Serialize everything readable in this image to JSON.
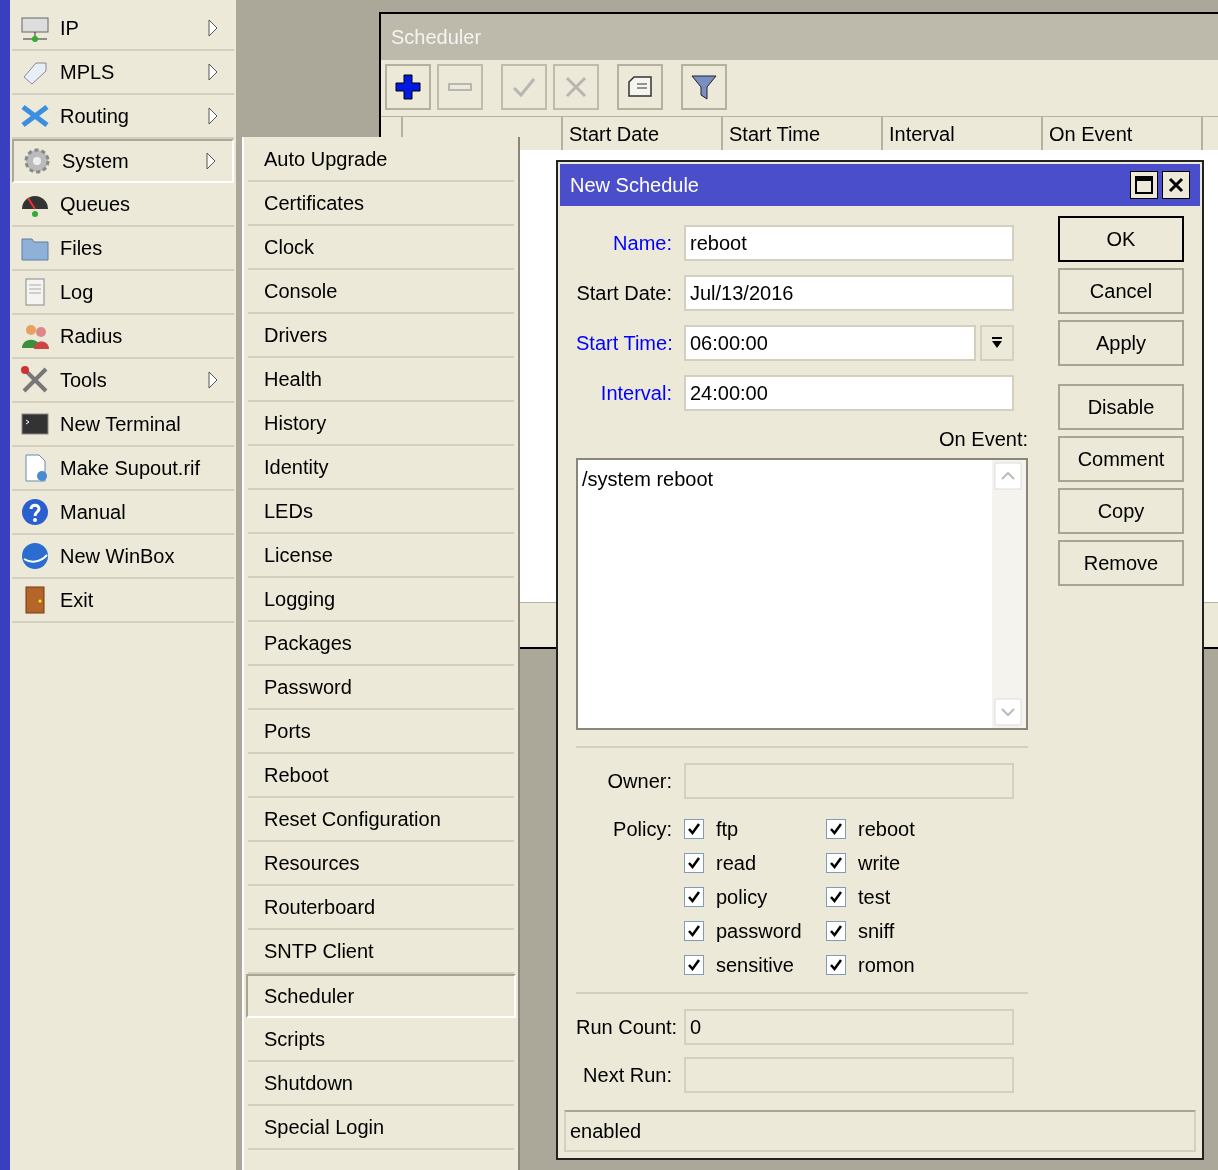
{
  "side_menu": {
    "items": [
      {
        "label": "IP",
        "submenu": true,
        "selected": false
      },
      {
        "label": "MPLS",
        "submenu": true,
        "selected": false
      },
      {
        "label": "Routing",
        "submenu": true,
        "selected": false
      },
      {
        "label": "System",
        "submenu": true,
        "selected": true
      },
      {
        "label": "Queues",
        "submenu": false,
        "selected": false
      },
      {
        "label": "Files",
        "submenu": false,
        "selected": false
      },
      {
        "label": "Log",
        "submenu": false,
        "selected": false
      },
      {
        "label": "Radius",
        "submenu": false,
        "selected": false
      },
      {
        "label": "Tools",
        "submenu": true,
        "selected": false
      },
      {
        "label": "New Terminal",
        "submenu": false,
        "selected": false
      },
      {
        "label": "Make Supout.rif",
        "submenu": false,
        "selected": false
      },
      {
        "label": "Manual",
        "submenu": false,
        "selected": false
      },
      {
        "label": "New WinBox",
        "submenu": false,
        "selected": false
      },
      {
        "label": "Exit",
        "submenu": false,
        "selected": false
      }
    ]
  },
  "submenu": {
    "items": [
      {
        "label": "Auto Upgrade",
        "selected": false
      },
      {
        "label": "Certificates",
        "selected": false
      },
      {
        "label": "Clock",
        "selected": false
      },
      {
        "label": "Console",
        "selected": false
      },
      {
        "label": "Drivers",
        "selected": false
      },
      {
        "label": "Health",
        "selected": false
      },
      {
        "label": "History",
        "selected": false
      },
      {
        "label": "Identity",
        "selected": false
      },
      {
        "label": "LEDs",
        "selected": false
      },
      {
        "label": "License",
        "selected": false
      },
      {
        "label": "Logging",
        "selected": false
      },
      {
        "label": "Packages",
        "selected": false
      },
      {
        "label": "Password",
        "selected": false
      },
      {
        "label": "Ports",
        "selected": false
      },
      {
        "label": "Reboot",
        "selected": false
      },
      {
        "label": "Reset Configuration",
        "selected": false
      },
      {
        "label": "Resources",
        "selected": false
      },
      {
        "label": "Routerboard",
        "selected": false
      },
      {
        "label": "SNTP Client",
        "selected": false
      },
      {
        "label": "Scheduler",
        "selected": true
      },
      {
        "label": "Scripts",
        "selected": false
      },
      {
        "label": "Shutdown",
        "selected": false
      },
      {
        "label": "Special Login",
        "selected": false
      }
    ]
  },
  "scheduler": {
    "title": "Scheduler",
    "toolbar": [
      {
        "kind": "add",
        "disabled": false
      },
      {
        "kind": "remove",
        "disabled": true
      },
      {
        "kind": "enable",
        "disabled": true
      },
      {
        "kind": "disable",
        "disabled": true
      },
      {
        "kind": "comment",
        "disabled": false
      },
      {
        "kind": "filter",
        "disabled": false
      }
    ],
    "columns": [
      "Start Date",
      "Start Time",
      "Interval",
      "On Event"
    ]
  },
  "dialog": {
    "title": "New Schedule",
    "fields": [
      {
        "label": "Name:",
        "value": "reboot",
        "required": true,
        "kind": "text"
      },
      {
        "label": "Start Date:",
        "value": "Jul/13/2016",
        "required": false,
        "kind": "text"
      },
      {
        "label": "Start Time:",
        "value": "06:00:00",
        "required": true,
        "kind": "dropdown"
      },
      {
        "label": "Interval:",
        "value": "24:00:00",
        "required": true,
        "kind": "text"
      }
    ],
    "on_event": {
      "label": "On Event:",
      "value": "/system reboot"
    },
    "owner": {
      "label": "Owner:"
    },
    "policy": {
      "label": "Policy:",
      "items": [
        {
          "label": "ftp",
          "checked": true
        },
        {
          "label": "read",
          "checked": true
        },
        {
          "label": "policy",
          "checked": true
        },
        {
          "label": "password",
          "checked": true
        },
        {
          "label": "sensitive",
          "checked": true
        },
        {
          "label": "reboot",
          "checked": true
        },
        {
          "label": "write",
          "checked": true
        },
        {
          "label": "test",
          "checked": true
        },
        {
          "label": "sniff",
          "checked": true
        },
        {
          "label": "romon",
          "checked": true
        }
      ]
    },
    "run_count": {
      "label": "Run Count:",
      "value": "0"
    },
    "next_run": {
      "label": "Next Run:"
    },
    "buttons": [
      {
        "label": "OK",
        "default": true
      },
      {
        "label": "Cancel",
        "default": false
      },
      {
        "label": "Apply",
        "default": false
      },
      {
        "label": "Disable",
        "default": false
      },
      {
        "label": "Comment",
        "default": false
      },
      {
        "label": "Copy",
        "default": false
      },
      {
        "label": "Remove",
        "default": false
      }
    ],
    "status": "enabled"
  }
}
